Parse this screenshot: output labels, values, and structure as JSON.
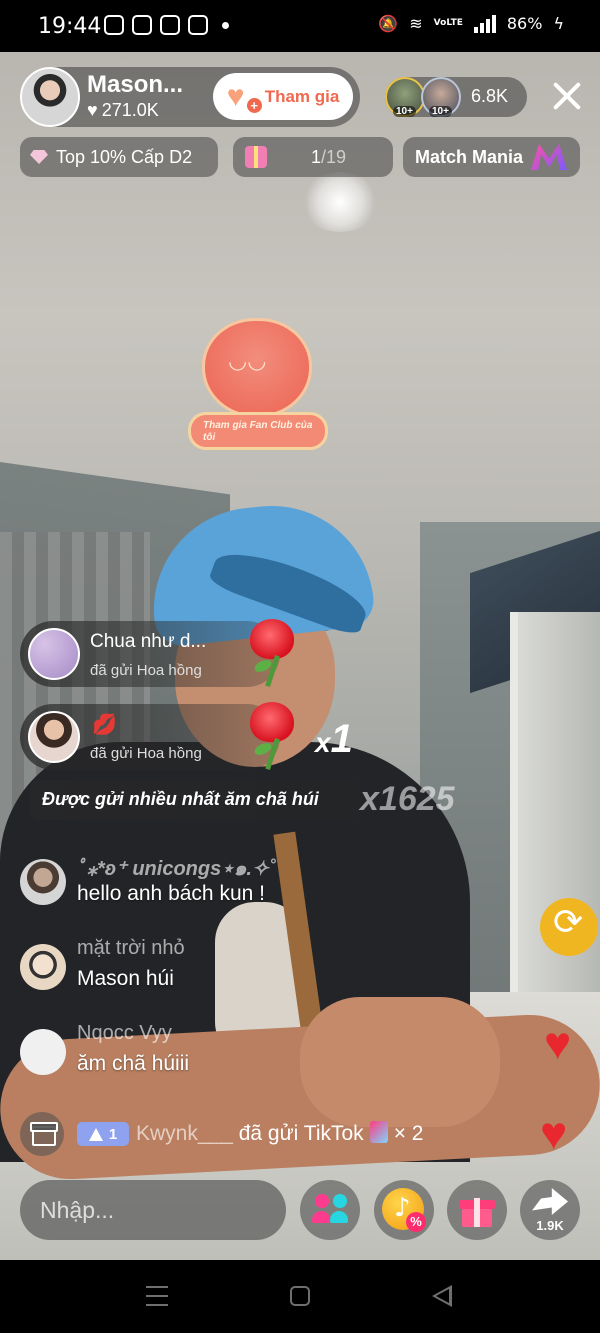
{
  "status_bar": {
    "time": "19:44",
    "battery": "86%",
    "network": "VoLTE"
  },
  "host": {
    "name": "Mason...",
    "likes": "271.0K",
    "join_label": "Tham gia"
  },
  "viewers": {
    "badges": [
      "10+",
      "10+"
    ],
    "count": "6.8K"
  },
  "chips": {
    "rank": "Top 10% Cấp D2",
    "task_current": "1",
    "task_total": "/19",
    "match": "Match Mania"
  },
  "fan_club_label": "Tham gia Fan Club của tôi",
  "gift_notifications": [
    {
      "user": "Chua như d...",
      "action": "đã gửi Hoa hồng"
    },
    {
      "user": "",
      "action": "đã gửi Hoa hồng"
    }
  ],
  "gift_multiplier": "1",
  "most_sent": {
    "label": "Được gửi nhiều nhất ăm chã húi",
    "count": "x1625"
  },
  "comments": [
    {
      "user": "ﾟ⁎*ʚ⁺ unicongs⋆๑.✧˚",
      "text": "hello anh bách kun !"
    },
    {
      "user": "mặt trời nhỏ",
      "text": "Mason húi"
    },
    {
      "user": "Nqocc Vyy",
      "text": "ăm chã húiii"
    }
  ],
  "gift_line": {
    "level": "1",
    "user": "Kwynk___",
    "action": "đã gửi TikTok",
    "multiplier": "× 2"
  },
  "bottom_bar": {
    "input_placeholder": "Nhập...",
    "share_count": "1.9K"
  },
  "icons": [
    "search-icon",
    "heart-icon",
    "close-icon",
    "gift-icon",
    "share-icon",
    "guests-icon",
    "tiktok-coin-icon",
    "rose-icon"
  ],
  "colors": {
    "accent": "#f0694f",
    "heart_red": "#e8272f",
    "share_yellow": "#f0b622",
    "level_badge": "#8ea2f0"
  }
}
